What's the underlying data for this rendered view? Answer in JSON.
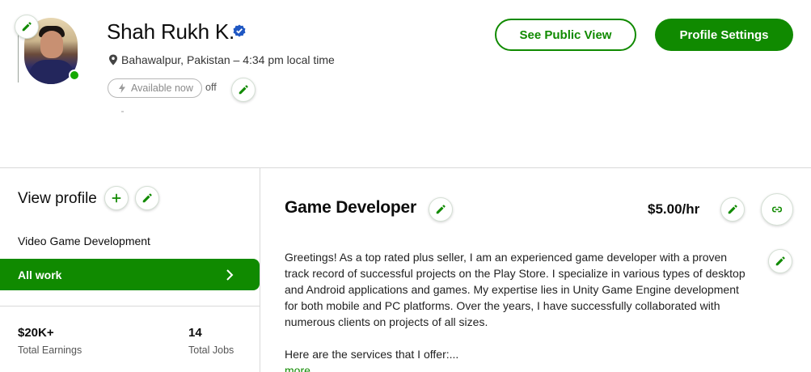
{
  "profile": {
    "name": "Shah Rukh K.",
    "location": "Bahawalpur, Pakistan – 4:34 pm local time",
    "availability_label": "Available now",
    "availability_state": "off"
  },
  "header": {
    "see_public_view": "See Public View",
    "profile_settings": "Profile Settings"
  },
  "sidebar": {
    "view_profile": "View profile",
    "specialty": "Video Game Development",
    "all_work": "All work",
    "stats": [
      {
        "value": "$20K+",
        "label": "Total Earnings"
      },
      {
        "value": "14",
        "label": "Total Jobs"
      }
    ]
  },
  "main": {
    "title": "Game Developer",
    "rate": "$5.00/hr",
    "bio": "Greetings! As a top rated plus seller, I am an experienced game developer with a proven track record of successful projects on the Play Store. I specialize in various types of desktop and Android applications and games. My expertise lies in Unity Game Engine development for both mobile and PC platforms. Over the years, I have successfully collaborated with numerous clients on projects of all sizes.",
    "services_intro": "Here are the services that I offer:...",
    "more": "more"
  },
  "colors": {
    "brand_green": "#108a00",
    "online_green": "#14a800",
    "verified_blue": "#1f57c3"
  },
  "icons": [
    "pencil-icon",
    "verified-badge-icon",
    "location-pin-icon",
    "lightning-icon",
    "plus-icon",
    "chevron-right-icon",
    "link-icon"
  ]
}
